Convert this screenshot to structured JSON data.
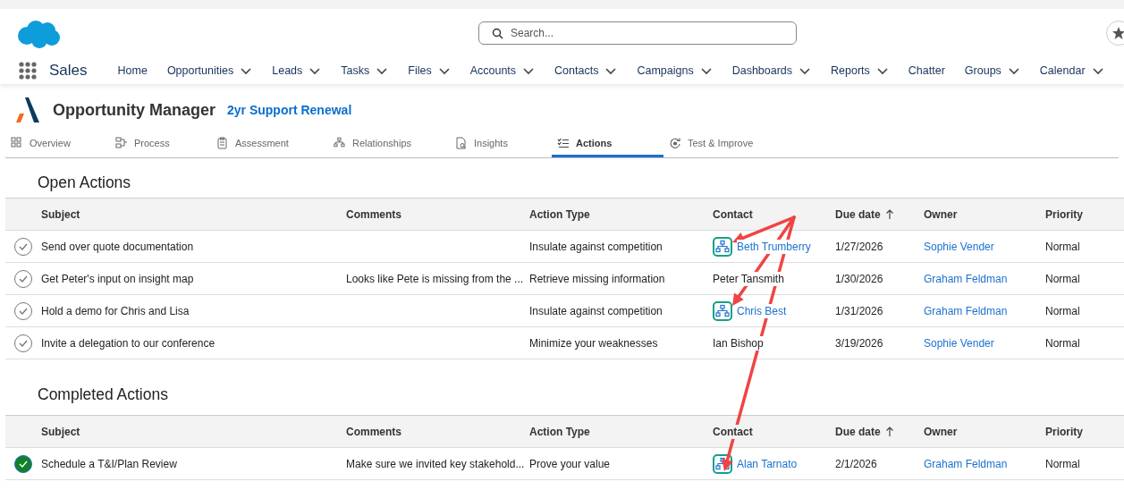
{
  "header": {
    "search": {
      "placeholder": "Search..."
    }
  },
  "nav": {
    "app_name": "Sales",
    "items": [
      {
        "label": "Home",
        "dropdown": false
      },
      {
        "label": "Opportunities",
        "dropdown": true
      },
      {
        "label": "Leads",
        "dropdown": true
      },
      {
        "label": "Tasks",
        "dropdown": true
      },
      {
        "label": "Files",
        "dropdown": true
      },
      {
        "label": "Accounts",
        "dropdown": true
      },
      {
        "label": "Contacts",
        "dropdown": true
      },
      {
        "label": "Campaigns",
        "dropdown": true
      },
      {
        "label": "Dashboards",
        "dropdown": true
      },
      {
        "label": "Reports",
        "dropdown": true
      },
      {
        "label": "Chatter",
        "dropdown": false
      },
      {
        "label": "Groups",
        "dropdown": true
      },
      {
        "label": "Calendar",
        "dropdown": true
      }
    ]
  },
  "app": {
    "title": "Opportunity Manager",
    "record": "2yr Support Renewal"
  },
  "tabs": [
    {
      "label": "Overview",
      "selected": false
    },
    {
      "label": "Process",
      "selected": false
    },
    {
      "label": "Assessment",
      "selected": false
    },
    {
      "label": "Relationships",
      "selected": false
    },
    {
      "label": "Insights",
      "selected": false
    },
    {
      "label": "Actions",
      "selected": true
    },
    {
      "label": "Test & Improve",
      "selected": false
    }
  ],
  "sections": [
    {
      "title": "Open Actions",
      "columns": [
        {
          "label": "Subject",
          "sorted": false
        },
        {
          "label": "Comments",
          "sorted": false
        },
        {
          "label": "Action Type",
          "sorted": false
        },
        {
          "label": "Contact",
          "sorted": false
        },
        {
          "label": "Due date",
          "sorted": true
        },
        {
          "label": "Owner",
          "sorted": false
        },
        {
          "label": "Priority",
          "sorted": false
        }
      ],
      "rows": [
        {
          "completed": false,
          "subject": "Send over quote documentation",
          "comments": "",
          "action_type": "Insulate against competition",
          "contact": {
            "name": "Beth Trumberry",
            "link": true,
            "map_icon": true,
            "highlighted": true
          },
          "due_date": "1/27/2026",
          "owner": "Sophie Vender",
          "priority": "Normal"
        },
        {
          "completed": false,
          "subject": "Get Peter's input on insight map",
          "comments": "Looks like Pete is missing from the ...",
          "action_type": "Retrieve missing information",
          "contact": {
            "name": "Peter Tansmith",
            "link": false,
            "map_icon": false,
            "highlighted": false
          },
          "due_date": "1/30/2026",
          "owner": "Graham Feldman",
          "priority": "Normal"
        },
        {
          "completed": false,
          "subject": "Hold a demo for Chris and Lisa",
          "comments": "",
          "action_type": "Insulate against competition",
          "contact": {
            "name": "Chris Best",
            "link": true,
            "map_icon": true,
            "highlighted": true
          },
          "due_date": "1/31/2026",
          "owner": "Graham Feldman",
          "priority": "Normal"
        },
        {
          "completed": false,
          "subject": "Invite a delegation to our conference",
          "comments": "",
          "action_type": "Minimize your weaknesses",
          "contact": {
            "name": "Ian Bishop",
            "link": false,
            "map_icon": false,
            "highlighted": false
          },
          "due_date": "3/19/2026",
          "owner": "Sophie Vender",
          "priority": "Normal"
        }
      ]
    },
    {
      "title": "Completed Actions",
      "columns": [
        {
          "label": "Subject",
          "sorted": false
        },
        {
          "label": "Comments",
          "sorted": false
        },
        {
          "label": "Action Type",
          "sorted": false
        },
        {
          "label": "Contact",
          "sorted": false
        },
        {
          "label": "Due date",
          "sorted": true
        },
        {
          "label": "Owner",
          "sorted": false
        },
        {
          "label": "Priority",
          "sorted": false
        }
      ],
      "rows": [
        {
          "completed": true,
          "subject": "Schedule a T&I/Plan Review",
          "comments": "Make sure we invited key stakehold...",
          "action_type": "Prove your value",
          "contact": {
            "name": "Alan Tarnato",
            "link": true,
            "map_icon": true,
            "highlighted": true
          },
          "due_date": "2/1/2026",
          "owner": "Graham Feldman",
          "priority": "Normal"
        }
      ]
    }
  ]
}
